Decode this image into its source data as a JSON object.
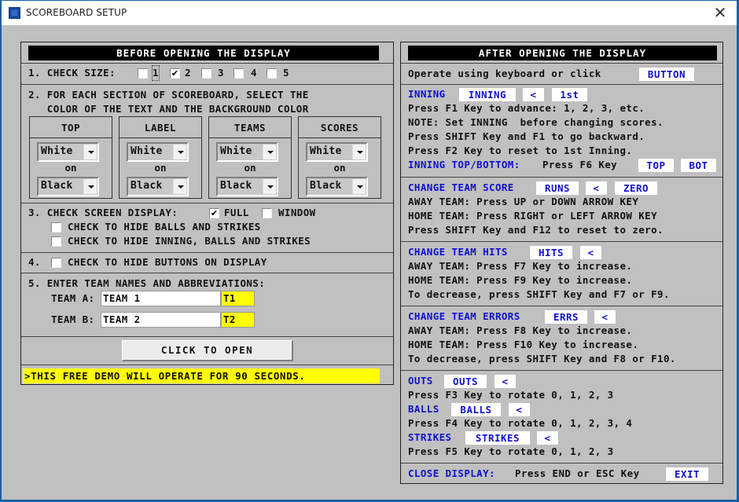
{
  "window": {
    "title": "SCOREBOARD SETUP",
    "close_icon": "close-icon"
  },
  "left": {
    "header": "BEFORE OPENING THE DISPLAY",
    "size": {
      "label": "1. CHECK SIZE:",
      "options": [
        {
          "label": "1",
          "checked": false,
          "focused": true
        },
        {
          "label": "2",
          "checked": true
        },
        {
          "label": "3",
          "checked": false
        },
        {
          "label": "4",
          "checked": false
        },
        {
          "label": "5",
          "checked": false
        }
      ]
    },
    "colors": {
      "line1": "2. FOR EACH SECTION OF SCOREBOARD, SELECT THE",
      "line2": "   COLOR OF THE TEXT AND THE BACKGROUND COLOR",
      "on_label": "on",
      "sections": [
        {
          "title": "TOP",
          "text": "White",
          "background": "Black"
        },
        {
          "title": "LABEL",
          "text": "White",
          "background": "Black"
        },
        {
          "title": "TEAMS",
          "text": "White",
          "background": "Black"
        },
        {
          "title": "SCORES",
          "text": "White",
          "background": "Black"
        }
      ]
    },
    "screen": {
      "label": "3. CHECK SCREEN DISPLAY:",
      "full_label": "FULL",
      "full_checked": true,
      "window_label": "WINDOW",
      "window_checked": false,
      "hide_balls_label": "CHECK TO HIDE BALLS AND STRIKES",
      "hide_balls_checked": false,
      "hide_inning_label": "CHECK TO HIDE INNING, BALLS AND STRIKES",
      "hide_inning_checked": false
    },
    "buttons_opt": {
      "prefix": "4.",
      "label": "CHECK TO HIDE BUTTONS ON DISPLAY",
      "checked": false
    },
    "teams": {
      "label": "5. ENTER TEAM NAMES AND ABBREVIATIONS:",
      "team_a_label": "TEAM A:",
      "team_a_name": "TEAM 1",
      "team_a_abbr": "T1",
      "team_b_label": "TEAM B:",
      "team_b_name": "TEAM 2",
      "team_b_abbr": "T2"
    },
    "open_button": "CLICK TO OPEN",
    "demo_notice": ">THIS FREE DEMO WILL OPERATE FOR 90 SECONDS."
  },
  "right": {
    "header": "AFTER OPENING THE DISPLAY",
    "operate": {
      "text": "Operate using keyboard or click",
      "button": "BUTTON"
    },
    "inning": {
      "title": "INNING",
      "buttons": [
        "INNING",
        "<",
        "1st"
      ],
      "lines": [
        "Press F1 Key to advance: 1, 2, 3, etc.",
        "NOTE: Set INNING  before changing scores.",
        "Press SHIFT Key and F1 to go backward.",
        "Press F2 Key to reset to 1st Inning."
      ],
      "topbot_label": "INNING TOP/BOTTOM:",
      "topbot_text": "Press F6 Key",
      "topbot_buttons": [
        "TOP",
        "BOT"
      ]
    },
    "score": {
      "title": "CHANGE TEAM SCORE",
      "buttons": [
        "RUNS",
        "<",
        "ZERO"
      ],
      "lines": [
        "AWAY TEAM: Press UP or DOWN ARROW KEY",
        "HOME TEAM: Press RIGHT or LEFT ARROW KEY",
        "Press SHIFT Key and F12 to reset to zero."
      ]
    },
    "hits": {
      "title": "CHANGE TEAM HITS",
      "buttons": [
        "HITS",
        "<"
      ],
      "lines": [
        "AWAY TEAM: Press F7 Key to increase.",
        "HOME TEAM: Press F9 Key to increase.",
        "To decrease, press SHIFT Key and F7 or F9."
      ]
    },
    "errors": {
      "title": "CHANGE TEAM ERRORS",
      "buttons": [
        "ERRS",
        "<"
      ],
      "lines": [
        "AWAY TEAM: Press F8 Key to increase.",
        "HOME TEAM: Press F10 Key to increase.",
        "To decrease, press SHIFT Key and F8 or F10."
      ]
    },
    "counts": {
      "outs_title": "OUTS",
      "outs_buttons": [
        "OUTS",
        "<"
      ],
      "outs_text": "Press F3 Key to rotate 0, 1, 2, 3",
      "balls_title": "BALLS",
      "balls_buttons": [
        "BALLS",
        "<"
      ],
      "balls_text": "Press F4 Key to rotate 0, 1, 2, 3, 4",
      "strikes_title": "STRIKES",
      "strikes_buttons": [
        "STRIKES",
        "<"
      ],
      "strikes_text": "Press F5 Key to rotate 0, 1, 2, 3"
    },
    "close": {
      "label": "CLOSE DISPLAY:",
      "text": "Press END or ESC Key",
      "button": "EXIT"
    }
  },
  "colors": {
    "accent_blue": "#1010d0",
    "yellow": "#ffff00",
    "header_black": "#000000",
    "window_gray": "#c0c0c0"
  }
}
